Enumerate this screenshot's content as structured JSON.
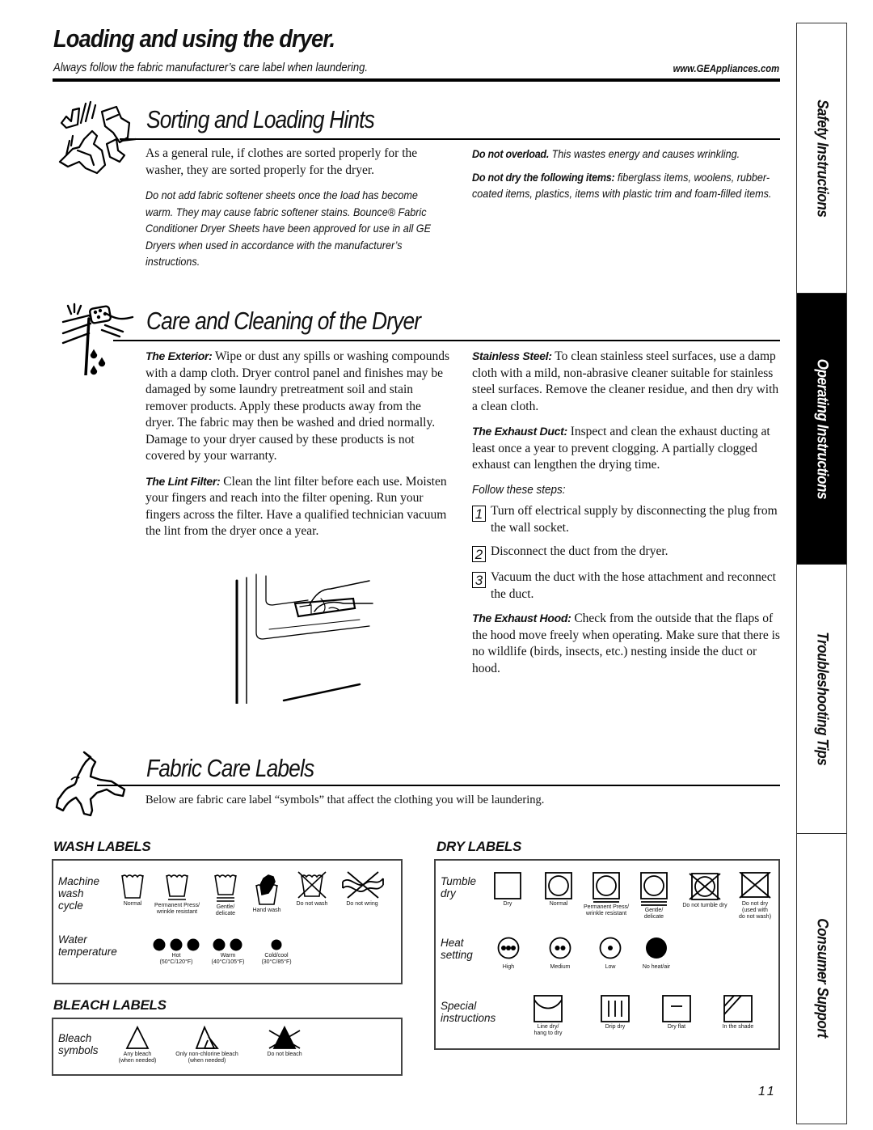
{
  "header": {
    "title": "Loading and using the dryer.",
    "subtitle": "Always follow the fabric manufacturer’s care label when laundering.",
    "website": "www.GEAppliances.com"
  },
  "sorting": {
    "title": "Sorting and Loading Hints",
    "icon": "tumbling-clothes-icon",
    "left": {
      "para1": "As a general rule, if clothes are sorted properly for the washer, they are sorted properly for the dryer.",
      "para2": "Do not add fabric softener sheets once the load has become warm. They may cause fabric softener stains. Bounce® Fabric Conditioner Dryer Sheets have been approved for use in all GE Dryers when used in accordance with the manufacturer’s instructions."
    },
    "right": {
      "overload_lead": "Do not overload.",
      "overload_text": " This wastes energy and causes wrinkling.",
      "items_lead": "Do not dry the following items:",
      "items_text": " fiberglass items, woolens, rubber-coated items, plastics, items with plastic trim and foam-filled items."
    }
  },
  "care": {
    "title": "Care and Cleaning of the Dryer",
    "icon": "sponge-wiping-icon",
    "exterior_lead": "The Exterior:",
    "exterior_text": " Wipe or dust any spills or washing compounds with a damp cloth. Dryer control panel and finishes may be damaged by some laundry pretreatment soil and stain remover products. Apply these products away from the dryer. The fabric may then be washed and dried normally. Damage to your dryer caused by these products is not covered by your warranty.",
    "lint_lead": "The Lint Filter:",
    "lint_text": " Clean the lint filter before each use. Moisten your fingers and reach into the filter opening. Run your fingers across the filter. Have a qualified technician vacuum the lint from the dryer once a year.",
    "lint_illustration": "lint-filter-illustration",
    "steel_lead": "Stainless Steel:",
    "steel_text": " To clean stainless steel surfaces, use a damp cloth with a mild, non-abrasive cleaner suitable for stainless steel surfaces. Remove the cleaner residue, and then dry with a clean cloth.",
    "duct_lead": "The Exhaust Duct:",
    "duct_text": " Inspect and clean the exhaust ducting at least once a year to prevent clogging. A partially clogged exhaust can lengthen the drying time.",
    "steps_heading": "Follow these steps:",
    "steps": [
      {
        "num": "1",
        "text": "Turn off electrical supply by disconnecting the plug from the wall socket."
      },
      {
        "num": "2",
        "text": "Disconnect the duct from the dryer."
      },
      {
        "num": "3",
        "text": "Vacuum the duct with the hose attachment and reconnect the duct."
      }
    ],
    "hood_lead": "The Exhaust Hood:",
    "hood_text": " Check from the outside that the flaps of the hood move freely when operating. Make sure that there is no wildlife (birds, insects, etc.) nesting inside the duct or hood."
  },
  "fabric": {
    "title": "Fabric Care Labels",
    "icon": "shirt-icon",
    "intro": "Below are fabric care label “symbols” that affect the clothing you will be laundering.",
    "wash": {
      "heading": "WASH LABELS",
      "row1_label": "Machine\nwash\ncycle",
      "row1": [
        {
          "icon": "wash-normal-icon",
          "caption": "Normal"
        },
        {
          "icon": "wash-permanent-press-icon",
          "caption": "Permanent Press/\nwrinkle resistant"
        },
        {
          "icon": "wash-gentle-icon",
          "caption": "Gentle/\ndelicate"
        },
        {
          "icon": "hand-wash-icon",
          "caption": "Hand wash"
        },
        {
          "icon": "do-not-wash-icon",
          "caption": "Do not wash"
        },
        {
          "icon": "do-not-wring-icon",
          "caption": "Do not wring"
        }
      ],
      "row2_label": "Water\ntemperature",
      "row2": [
        {
          "icon": "three-dots-hot-icon",
          "caption": "Hot\n(50°C/120°F)"
        },
        {
          "icon": "two-dots-warm-icon",
          "caption": "Warm\n(40°C/105°F)"
        },
        {
          "icon": "one-dot-cold-icon",
          "caption": "Cold/cool\n(30°C/85°F)"
        }
      ]
    },
    "bleach": {
      "heading": "BLEACH LABELS",
      "row_label": "Bleach\nsymbols",
      "items": [
        {
          "icon": "any-bleach-icon",
          "caption": "Any bleach\n(when needed)"
        },
        {
          "icon": "non-chlorine-bleach-icon",
          "caption": "Only non-chlorine bleach\n(when needed)"
        },
        {
          "icon": "do-not-bleach-icon",
          "caption": "Do not bleach"
        }
      ]
    },
    "dry": {
      "heading": "DRY LABELS",
      "row1_label": "Tumble\ndry",
      "row1": [
        {
          "icon": "dry-icon",
          "caption": "Dry"
        },
        {
          "icon": "tumble-normal-icon",
          "caption": "Normal"
        },
        {
          "icon": "tumble-permanent-press-icon",
          "caption": "Permanent Press/\nwrinkle resistant"
        },
        {
          "icon": "tumble-gentle-icon",
          "caption": "Gentle/\ndelicate"
        },
        {
          "icon": "do-not-tumble-dry-icon",
          "caption": "Do not tumble dry"
        },
        {
          "icon": "do-not-dry-icon",
          "caption": "Do not dry\n(used with\ndo not wash)"
        }
      ],
      "row2_label": "Heat\nsetting",
      "row2": [
        {
          "icon": "heat-high-icon",
          "caption": "High"
        },
        {
          "icon": "heat-medium-icon",
          "caption": "Medium"
        },
        {
          "icon": "heat-low-icon",
          "caption": "Low"
        },
        {
          "icon": "no-heat-icon",
          "caption": "No heat/air"
        }
      ],
      "row3_label": "Special\ninstructions",
      "row3": [
        {
          "icon": "line-dry-icon",
          "caption": "Line dry/\nhang to dry"
        },
        {
          "icon": "drip-dry-icon",
          "caption": "Drip dry"
        },
        {
          "icon": "dry-flat-icon",
          "caption": "Dry flat"
        },
        {
          "icon": "in-the-shade-icon",
          "caption": "In the shade"
        }
      ]
    }
  },
  "side_tabs": [
    {
      "label": "Safety Instructions",
      "active": false
    },
    {
      "label": "Operating Instructions",
      "active": true
    },
    {
      "label": "Troubleshooting Tips",
      "active": false
    },
    {
      "label": "Consumer Support",
      "active": false
    }
  ],
  "page_number": "11"
}
